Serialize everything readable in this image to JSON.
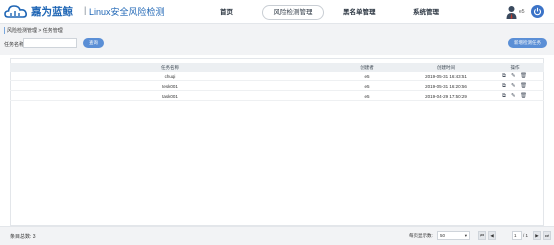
{
  "header": {
    "brand": "嘉为蓝鲸",
    "separator": "|",
    "product": "Linux安全风险检测",
    "nav": [
      {
        "label": "首页"
      },
      {
        "label": "风险检测管理",
        "active": true
      },
      {
        "label": "黑名单管理"
      },
      {
        "label": "系统管理"
      }
    ],
    "user": "e5",
    "icons": {
      "logo": "cloud-logo-icon",
      "avatar": "user-avatar-icon",
      "power": "power-icon"
    },
    "accent_color": "#3b73c7"
  },
  "breadcrumb": "风险检测管理 > 任务管理",
  "filter": {
    "label": "任务名称:",
    "value": "",
    "query_button": "查询"
  },
  "new_button": "新增检测任务",
  "table": {
    "columns": [
      "任务名称",
      "创建者",
      "创建时间",
      "操作"
    ],
    "rows": [
      {
        "name": "chuqi",
        "creator": "e5",
        "time": "2019-05-31 16:43:51"
      },
      {
        "name": "tesk001",
        "creator": "e5",
        "time": "2019-05-31 16:20:56"
      },
      {
        "name": "task001",
        "creator": "e5",
        "time": "2019-04-29 17:50:29"
      }
    ],
    "action_icons": [
      "copy-icon",
      "edit-icon",
      "delete-icon"
    ]
  },
  "footer": {
    "total_label": "条目总数:",
    "total": "3",
    "per_page_label": "每页显示数:",
    "per_page": "50",
    "current_page": "1",
    "page_total": "/ 1"
  }
}
